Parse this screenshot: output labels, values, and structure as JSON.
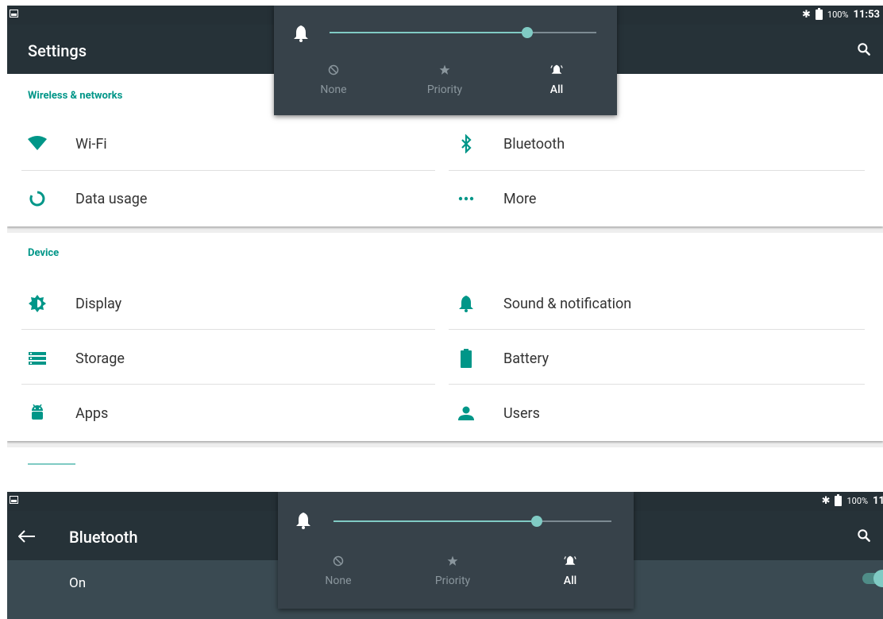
{
  "screen1": {
    "status": {
      "battery_pct": "100%",
      "time": "11:53"
    },
    "title": "Settings",
    "volume": {
      "level": 0.74,
      "modes": [
        {
          "label": "None",
          "icon": "no-interruptions-icon"
        },
        {
          "label": "Priority",
          "icon": "star-icon"
        },
        {
          "label": "All",
          "icon": "bell-ringing-icon",
          "active": true
        }
      ]
    },
    "sections": [
      {
        "header": "Wireless & networks",
        "items": [
          {
            "label": "Wi-Fi",
            "icon": "wifi-icon"
          },
          {
            "label": "Bluetooth",
            "icon": "bluetooth-icon"
          },
          {
            "label": "Data usage",
            "icon": "data-usage-icon"
          },
          {
            "label": "More",
            "icon": "more-dots-icon"
          }
        ]
      },
      {
        "header": "Device",
        "items": [
          {
            "label": "Display",
            "icon": "brightness-icon"
          },
          {
            "label": "Sound & notification",
            "icon": "bell-icon"
          },
          {
            "label": "Storage",
            "icon": "storage-icon"
          },
          {
            "label": "Battery",
            "icon": "battery-icon"
          },
          {
            "label": "Apps",
            "icon": "android-icon"
          },
          {
            "label": "Users",
            "icon": "person-icon"
          }
        ]
      }
    ]
  },
  "screen2": {
    "status": {
      "battery_pct": "100%",
      "time": "11"
    },
    "title": "Bluetooth",
    "on_label": "On",
    "volume": {
      "level": 0.73,
      "modes": [
        {
          "label": "None"
        },
        {
          "label": "Priority"
        },
        {
          "label": "All",
          "active": true
        }
      ]
    }
  },
  "colors": {
    "accent": "#009688",
    "actionbar": "#263238",
    "statusbar": "#253036",
    "popup": "#37424a",
    "slider": "#80cbc4"
  }
}
